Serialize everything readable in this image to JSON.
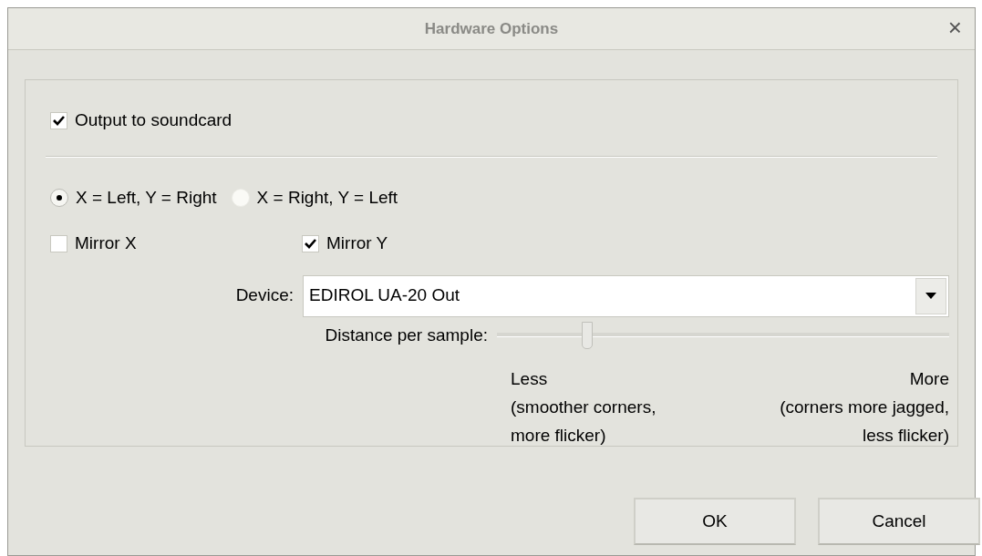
{
  "window": {
    "title": "Hardware Options",
    "close": "×"
  },
  "output": {
    "label": "Output to soundcard",
    "checked": true
  },
  "channels": [
    {
      "label": "X = Left, Y = Right",
      "selected": true
    },
    {
      "label": "X = Right, Y = Left",
      "selected": false
    }
  ],
  "mirrors": [
    {
      "label": "Mirror X",
      "checked": false
    },
    {
      "label": "Mirror Y",
      "checked": true
    }
  ],
  "device": {
    "label": "Device:",
    "value": "EDIROL UA-20 Out"
  },
  "distance": {
    "label": "Distance per sample:",
    "level": 0.2,
    "less": [
      "Less",
      "(smoother corners,",
      "more flicker)"
    ],
    "more": [
      "More",
      "(corners more jagged,",
      "less flicker)"
    ]
  },
  "buttons": [
    "OK",
    "Cancel"
  ]
}
